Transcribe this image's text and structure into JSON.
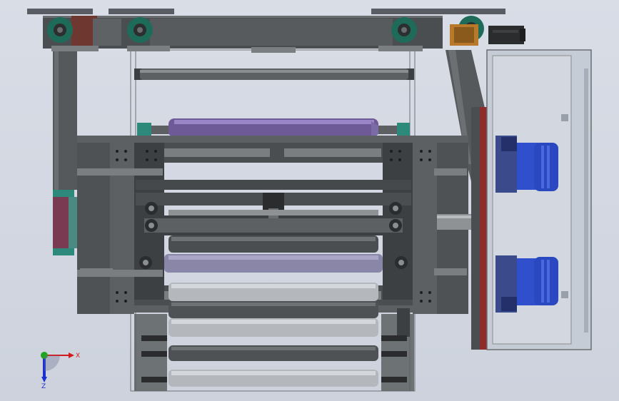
{
  "viewport": {
    "background": "#d3d7e0"
  },
  "triad": {
    "x_label": "X",
    "z_label": "Z",
    "x_color": "#d21a1a",
    "y_color": "#1fa51f",
    "z_color": "#1a2fd2"
  },
  "colors": {
    "frame": "#5c6062",
    "frame_dark": "#3c4042",
    "roller_gray": "#8e9294",
    "roller_light": "#b4b8bc",
    "roller_purple": "#6e5a96",
    "motor_blue": "#2f4fcc",
    "accent_teal": "#2d8a7a",
    "accent_brown": "#7a3a30",
    "accent_red": "#8e2b2b",
    "bearing_teal": "#1f6b5a",
    "gold": "#b87a2a",
    "panel": "#c6ccd6"
  }
}
